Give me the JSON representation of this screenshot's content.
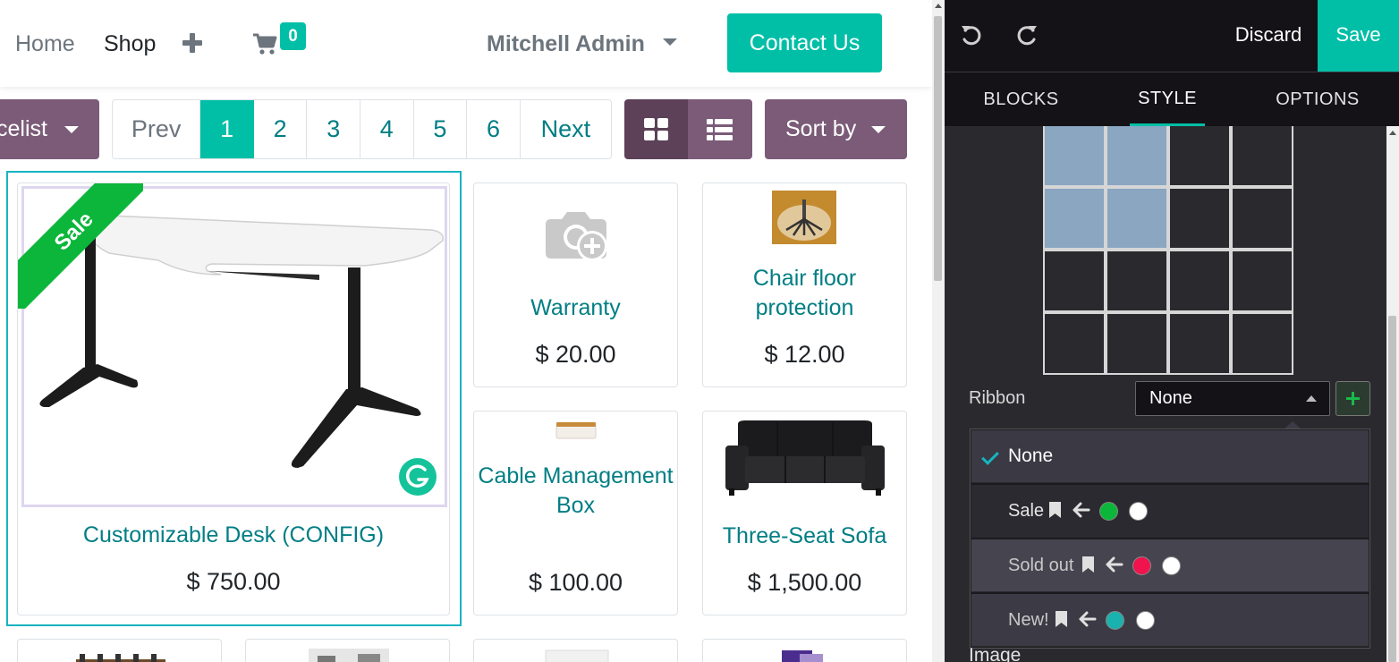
{
  "navbar": {
    "home": "Home",
    "shop": "Shop",
    "cart_count": "0",
    "user": "Mitchell Admin",
    "contact": "Contact Us"
  },
  "toolbar": {
    "pricelist": "celist",
    "pager": {
      "prev": "Prev",
      "pages": [
        "1",
        "2",
        "3",
        "4",
        "5",
        "6"
      ],
      "active": "1",
      "next": "Next"
    },
    "sort": "Sort by"
  },
  "products": [
    {
      "name": "Customizable Desk (CONFIG)",
      "price": "$ 750.00",
      "ribbon": "Sale"
    },
    {
      "name": "Warranty",
      "price": "$ 20.00"
    },
    {
      "name": "Chair floor protection",
      "price": "$ 12.00"
    },
    {
      "name": "Cable Management Box",
      "price": "$ 100.00"
    },
    {
      "name": "Three-Seat Sofa",
      "price": "$ 1,500.00"
    }
  ],
  "editor": {
    "discard": "Discard",
    "save": "Save",
    "tabs": {
      "blocks": "BLOCKS",
      "style": "STYLE",
      "options": "OPTIONS"
    },
    "active_tab": "STYLE",
    "grid_size": {
      "columns": 4,
      "rows": 4,
      "selected_columns": 2,
      "selected_rows": 2
    },
    "ribbon_label": "Ribbon",
    "ribbon_value": "None",
    "ribbon_options": [
      {
        "label": "None",
        "selected": true
      },
      {
        "label": "Sale",
        "bg_color": "#0bb63a",
        "text_color": "#ffffff"
      },
      {
        "label": "Sold out",
        "bg_color": "#f0134d",
        "text_color": "#ffffff"
      },
      {
        "label": "New!",
        "bg_color": "#1ab2ae",
        "text_color": "#ffffff"
      }
    ],
    "image_label": "Image"
  },
  "colors": {
    "brand_teal": "#00bfa6",
    "primary_purple": "#7b5b78",
    "link_teal": "#017e84"
  }
}
